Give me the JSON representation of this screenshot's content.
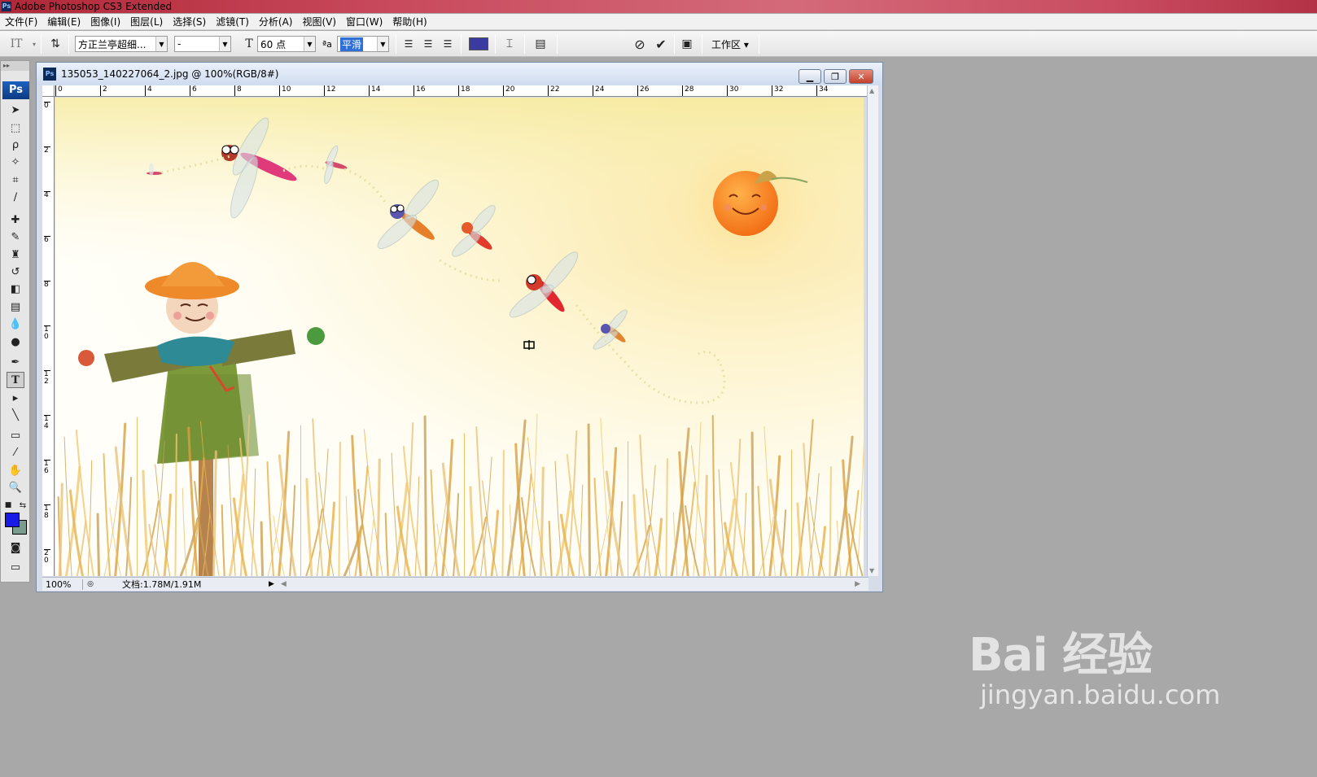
{
  "app": {
    "title": "Adobe Photoshop CS3 Extended",
    "logo_text": "Ps"
  },
  "menu": [
    {
      "label": "文件(F)"
    },
    {
      "label": "编辑(E)"
    },
    {
      "label": "图像(I)"
    },
    {
      "label": "图层(L)"
    },
    {
      "label": "选择(S)"
    },
    {
      "label": "滤镜(T)"
    },
    {
      "label": "分析(A)"
    },
    {
      "label": "视图(V)"
    },
    {
      "label": "窗口(W)"
    },
    {
      "label": "帮助(H)"
    }
  ],
  "options": {
    "font_family": "方正兰亭超细...",
    "font_style": "-",
    "font_size": "60 点",
    "aa_label": "ªa",
    "antialias": "平滑",
    "text_color": "#3a3aa0",
    "workspace": "工作区 ▾"
  },
  "tools": [
    "move-tool-icon",
    "marquee-tool-icon",
    "lasso-tool-icon",
    "magic-wand-icon",
    "crop-tool-icon",
    "slice-tool-icon",
    "healing-brush-icon",
    "brush-tool-icon",
    "clone-stamp-icon",
    "history-brush-icon",
    "eraser-icon",
    "gradient-icon",
    "blur-icon",
    "dodge-icon",
    "pen-tool-icon",
    "type-tool-icon",
    "path-select-icon",
    "line-tool-icon",
    "notes-icon",
    "eyedropper-icon",
    "hand-tool-icon",
    "zoom-tool-icon"
  ],
  "colors": {
    "foreground": "#1a1ae8",
    "background": "#7a9c8f"
  },
  "document": {
    "title": "135053_140227064_2.jpg @ 100%(RGB/8#)",
    "ruler_h": [
      "0",
      "2",
      "4",
      "6",
      "8",
      "10",
      "12",
      "14",
      "16",
      "18",
      "20",
      "22",
      "24",
      "26",
      "28",
      "30",
      "32",
      "34"
    ],
    "ruler_v": [
      "0",
      "2",
      "4",
      "6",
      "8",
      "1 0",
      "1 2",
      "1 4",
      "1 6",
      "1 8",
      "2 0"
    ],
    "zoom": "100%",
    "doc_info": "文档:1.78M/1.91M"
  },
  "watermark": {
    "main": "Bai 经验",
    "url": "jingyan.baidu.com"
  }
}
